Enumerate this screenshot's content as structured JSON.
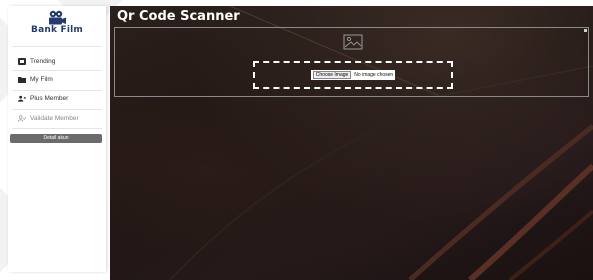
{
  "brand": {
    "name": "Bank Film"
  },
  "sidebar": {
    "items": [
      {
        "label": "Trending",
        "icon": "film-icon"
      },
      {
        "label": "My Film",
        "icon": "folder-icon"
      },
      {
        "label": "Plus Member",
        "icon": "user-plus-icon"
      },
      {
        "label": "Validate Member",
        "icon": "user-check-icon"
      }
    ],
    "detail_button": "Detail akun"
  },
  "main": {
    "title": "Qr Code Scanner",
    "file_input": {
      "button_label": "Choose Image",
      "status": "No image chosen"
    }
  },
  "colors": {
    "brand": "#233b6e",
    "button": "#6b6b6b",
    "dashed_border": "#ffffff"
  }
}
